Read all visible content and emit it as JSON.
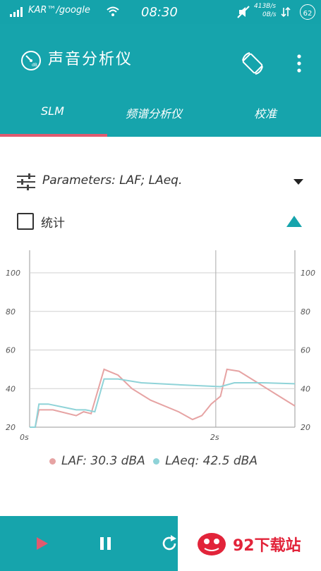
{
  "statusbar": {
    "carrier": "KAR™/google",
    "time": "08:30",
    "speed_up": "413B/s",
    "speed_down": "0B/s",
    "battery": "62"
  },
  "appbar": {
    "title": "声音分析仪",
    "icons": {
      "logo": "sound-meter-logo-icon",
      "rotate": "screen-rotate-icon",
      "menu": "more-vert-icon"
    }
  },
  "tabs": [
    {
      "label": "SLM",
      "active": true
    },
    {
      "label": "频谱分析仪",
      "active": false
    },
    {
      "label": "校准",
      "active": false
    }
  ],
  "parameters": {
    "label": "Parameters: LAF; LAeq."
  },
  "stats": {
    "label": "统计",
    "checked": false
  },
  "chart_data": {
    "type": "line",
    "y_ticks": [
      "100",
      "80",
      "60",
      "40",
      "20"
    ],
    "x_ticks": [
      "0s",
      "2s"
    ],
    "ylim": [
      20,
      100
    ],
    "xlim": [
      0,
      2.85
    ],
    "grid": true,
    "series": [
      {
        "name": "LAF",
        "color": "#e6a3a3",
        "points": [
          [
            0.0,
            20
          ],
          [
            0.06,
            20
          ],
          [
            0.1,
            29
          ],
          [
            0.25,
            29
          ],
          [
            0.5,
            26
          ],
          [
            0.58,
            28
          ],
          [
            0.66,
            27
          ],
          [
            0.8,
            50
          ],
          [
            0.95,
            47
          ],
          [
            1.1,
            40
          ],
          [
            1.3,
            34
          ],
          [
            1.6,
            28
          ],
          [
            1.75,
            24
          ],
          [
            1.85,
            26
          ],
          [
            1.95,
            32
          ],
          [
            2.05,
            36
          ],
          [
            2.12,
            50
          ],
          [
            2.25,
            49
          ],
          [
            2.45,
            43
          ],
          [
            2.65,
            37
          ],
          [
            2.85,
            31
          ]
        ]
      },
      {
        "name": "LAeq",
        "color": "#8fd3d8",
        "points": [
          [
            0.0,
            20
          ],
          [
            0.06,
            20
          ],
          [
            0.1,
            32
          ],
          [
            0.2,
            32
          ],
          [
            0.4,
            30
          ],
          [
            0.5,
            29
          ],
          [
            0.6,
            29
          ],
          [
            0.7,
            28
          ],
          [
            0.8,
            45
          ],
          [
            0.95,
            45
          ],
          [
            1.2,
            43
          ],
          [
            1.6,
            42
          ],
          [
            2.05,
            41
          ],
          [
            2.2,
            43
          ],
          [
            2.5,
            43
          ],
          [
            2.85,
            42.5
          ]
        ]
      }
    ],
    "legend": [
      {
        "label": "LAF: 30.3 dBA",
        "color": "#e6a3a3"
      },
      {
        "label": "LAeq: 42.5 dBA",
        "color": "#8fd3d8"
      }
    ]
  },
  "bottombar": {
    "icons": [
      "play-icon",
      "pause-icon",
      "refresh-icon"
    ],
    "colors": {
      "play": "#e05a6f",
      "pause": "#ffffff",
      "refresh": "#ffffff"
    }
  },
  "watermark": {
    "text": "92下载站"
  },
  "colors": {
    "primary": "#16a4ac",
    "accent": "#e05a6f"
  }
}
